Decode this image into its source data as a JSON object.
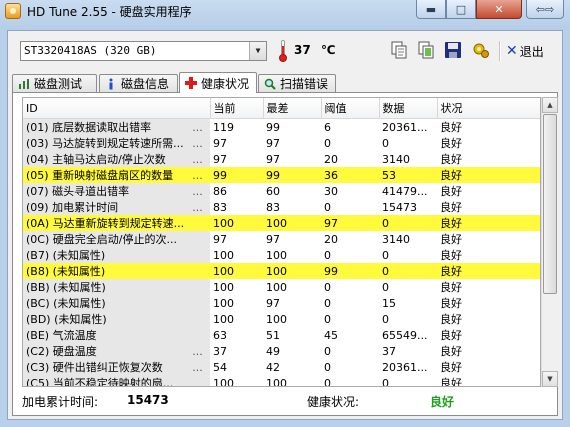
{
  "window": {
    "title": "HD Tune 2.55 - 硬盘实用程序"
  },
  "toolbar": {
    "drive": "ST3320418AS (320 GB)",
    "temperature": "37",
    "temperature_unit": "℃",
    "exit_label": "退出"
  },
  "tabs": [
    "磁盘测试",
    "磁盘信息",
    "健康状况",
    "扫描错误"
  ],
  "table": {
    "headers": [
      "ID",
      "当前",
      "最差",
      "阈值",
      "数据",
      "状况"
    ],
    "rows": [
      {
        "id": "(01) 底层数据读取出错率",
        "dots": "...",
        "current": "119",
        "worst": "99",
        "threshold": "6",
        "data": "20361...",
        "status": "良好",
        "hl": false
      },
      {
        "id": "(03) 马达旋转到规定转速所需...",
        "dots": "...",
        "current": "97",
        "worst": "97",
        "threshold": "0",
        "data": "0",
        "status": "良好",
        "hl": false
      },
      {
        "id": "(04) 主轴马达启动/停止次数",
        "dots": "...",
        "current": "97",
        "worst": "97",
        "threshold": "20",
        "data": "3140",
        "status": "良好",
        "hl": false
      },
      {
        "id": "(05) 重新映射磁盘扇区的数量",
        "dots": "...",
        "current": "99",
        "worst": "99",
        "threshold": "36",
        "data": "53",
        "status": "良好",
        "hl": true
      },
      {
        "id": "(07) 磁头寻道出错率",
        "dots": "...",
        "current": "86",
        "worst": "60",
        "threshold": "30",
        "data": "41479...",
        "status": "良好",
        "hl": false
      },
      {
        "id": "(09) 加电累计时间",
        "dots": "...",
        "current": "83",
        "worst": "83",
        "threshold": "0",
        "data": "15473",
        "status": "良好",
        "hl": false
      },
      {
        "id": "(0A) 马达重新旋转到规定转速...",
        "dots": "",
        "current": "100",
        "worst": "100",
        "threshold": "97",
        "data": "0",
        "status": "良好",
        "hl": true
      },
      {
        "id": "(0C) 硬盘完全启动/停止的次...",
        "dots": "",
        "current": "97",
        "worst": "97",
        "threshold": "20",
        "data": "3140",
        "status": "良好",
        "hl": false
      },
      {
        "id": "(B7) (未知属性)",
        "dots": "",
        "current": "100",
        "worst": "100",
        "threshold": "0",
        "data": "0",
        "status": "良好",
        "hl": false
      },
      {
        "id": "(B8) (未知属性)",
        "dots": "",
        "current": "100",
        "worst": "100",
        "threshold": "99",
        "data": "0",
        "status": "良好",
        "hl": true
      },
      {
        "id": "(BB) (未知属性)",
        "dots": "",
        "current": "100",
        "worst": "100",
        "threshold": "0",
        "data": "0",
        "status": "良好",
        "hl": false
      },
      {
        "id": "(BC) (未知属性)",
        "dots": "",
        "current": "100",
        "worst": "97",
        "threshold": "0",
        "data": "15",
        "status": "良好",
        "hl": false
      },
      {
        "id": "(BD) (未知属性)",
        "dots": "",
        "current": "100",
        "worst": "100",
        "threshold": "0",
        "data": "0",
        "status": "良好",
        "hl": false
      },
      {
        "id": "(BE) 气流温度",
        "dots": "",
        "current": "63",
        "worst": "51",
        "threshold": "45",
        "data": "65549...",
        "status": "良好",
        "hl": false
      },
      {
        "id": "(C2) 硬盘温度",
        "dots": "...",
        "current": "37",
        "worst": "49",
        "threshold": "0",
        "data": "37",
        "status": "良好",
        "hl": false
      },
      {
        "id": "(C3) 硬件出错纠正恢复次数",
        "dots": "...",
        "current": "54",
        "worst": "42",
        "threshold": "0",
        "data": "20361...",
        "status": "良好",
        "hl": false
      },
      {
        "id": "(C5) 当前不稳定待映射的扇...",
        "dots": "",
        "current": "100",
        "worst": "100",
        "threshold": "0",
        "data": "0",
        "status": "良好",
        "hl": false
      }
    ]
  },
  "status": {
    "poweron_label": "加电累计时间:",
    "poweron_value": "15473",
    "health_label": "健康状况:",
    "health_value": "良好"
  }
}
